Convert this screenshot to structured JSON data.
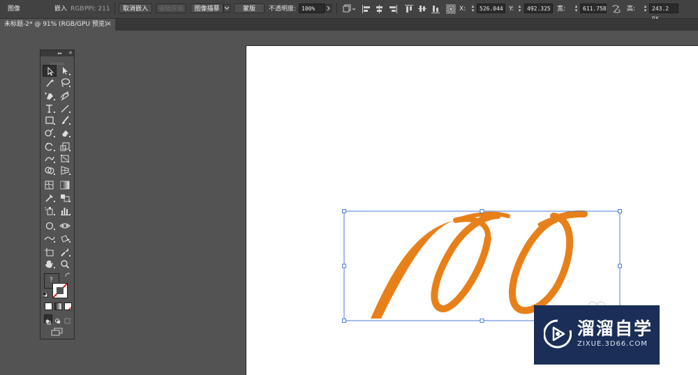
{
  "control_bar": {
    "object_type": "图像",
    "embed_label": "嵌入",
    "color_mode": "RGB",
    "ppi_label": "PPI: 211",
    "unembed_button": "取消嵌入",
    "edit_original_button": "编辑原稿",
    "image_trace_button": "图像描摹",
    "mask_button": "蒙版",
    "opacity_label": "不透明度:",
    "opacity_value": "100%",
    "x_label": "X:",
    "x_value": "526.044",
    "y_label": "Y:",
    "y_value": "492.325",
    "width_label": "宽:",
    "width_value": "611.758",
    "height_label": "高:",
    "height_value": "243.2 px"
  },
  "document_tab": {
    "title": "未标题-2* @ 91% (RGB/GPU 预览)",
    "close_glyph": "✕"
  },
  "tools_panel": {
    "collapse_glyph": "◂◂",
    "close_glyph": "✕",
    "unknown_tool_glyph": "?",
    "tools": [
      "selection-tool",
      "direct-selection-tool",
      "magic-wand-tool",
      "lasso-tool",
      "pen-tool",
      "curvature-tool",
      "type-tool",
      "line-segment-tool",
      "rectangle-tool",
      "paintbrush-tool",
      "shaper-tool",
      "eraser-tool",
      "rotate-tool",
      "scale-tool",
      "warp-tool",
      "free-transform-tool",
      "shape-builder-tool",
      "perspective-grid-tool",
      "mesh-tool",
      "gradient-tool",
      "eyedropper-tool",
      "blend-tool",
      "symbol-sprayer-tool",
      "column-graph-tool",
      "artboard-tool",
      "slice-tool",
      "hand-tool",
      "zoom-tool"
    ]
  },
  "colors": {
    "ui_background": "#535353",
    "control_bar": "#424242",
    "artwork_orange": "#E8801A",
    "selection_blue": "#4A7BD6",
    "watermark_bg": "#1A2E57"
  },
  "watermark": {
    "title": "溜溜自学",
    "url": "ZIXUE.3D66.COM"
  }
}
